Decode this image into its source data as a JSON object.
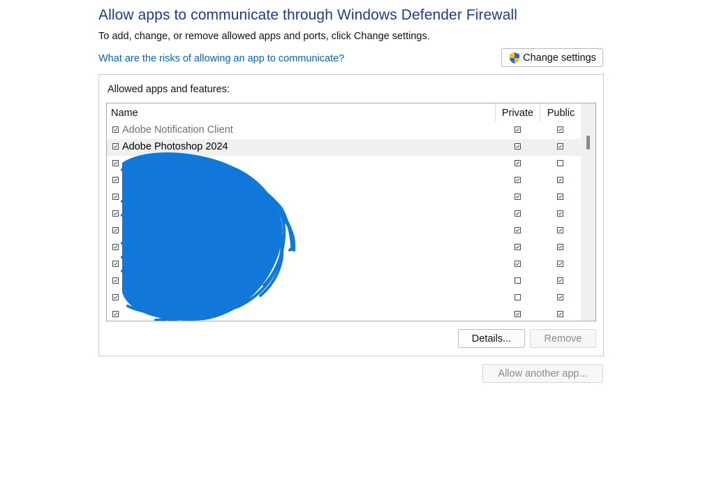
{
  "header": {
    "title": "Allow apps to communicate through Windows Defender Firewall",
    "subtitle": "To add, change, or remove allowed apps and ports, click Change settings.",
    "risk_link": "What are the risks of allowing an app to communicate?",
    "change_settings_label": "Change settings"
  },
  "apps_group": {
    "label": "Allowed apps and features:",
    "columns": {
      "name": "Name",
      "private": "Private",
      "public": "Public"
    },
    "rows": [
      {
        "name": "Adobe Notification Client",
        "enabled": true,
        "private": true,
        "public": true,
        "dimmed": true,
        "selected": false
      },
      {
        "name": "Adobe Photoshop 2024",
        "enabled": true,
        "private": true,
        "public": true,
        "dimmed": false,
        "selected": true
      },
      {
        "name": "",
        "enabled": true,
        "private": true,
        "public": false,
        "dimmed": false,
        "selected": false
      },
      {
        "name": "",
        "enabled": true,
        "private": true,
        "public": true,
        "dimmed": false,
        "selected": false
      },
      {
        "name": "",
        "enabled": true,
        "private": true,
        "public": true,
        "dimmed": false,
        "selected": false
      },
      {
        "name": "",
        "enabled": true,
        "private": true,
        "public": true,
        "dimmed": false,
        "selected": false
      },
      {
        "name": "",
        "enabled": true,
        "private": true,
        "public": true,
        "dimmed": false,
        "selected": false
      },
      {
        "name": "",
        "enabled": true,
        "private": true,
        "public": true,
        "dimmed": false,
        "selected": false
      },
      {
        "name": "",
        "enabled": true,
        "private": true,
        "public": true,
        "dimmed": false,
        "selected": false
      },
      {
        "name": "",
        "enabled": true,
        "private": false,
        "public": true,
        "dimmed": false,
        "selected": false
      },
      {
        "name": "",
        "enabled": true,
        "private": false,
        "public": true,
        "dimmed": false,
        "selected": false
      },
      {
        "name": "",
        "enabled": true,
        "private": true,
        "public": true,
        "dimmed": false,
        "selected": false
      }
    ],
    "details_label": "Details...",
    "remove_label": "Remove"
  },
  "footer": {
    "allow_another_label": "Allow another app..."
  },
  "colors": {
    "title": "#1f3b8a",
    "link": "#0b64b3",
    "check": "#1a6f9a",
    "redaction": "#0a74d8"
  }
}
